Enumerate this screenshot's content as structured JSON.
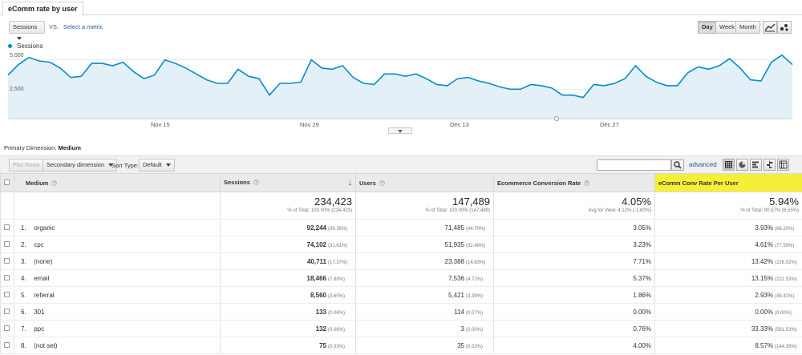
{
  "tab": {
    "label": "eComm rate by user"
  },
  "controls": {
    "metric_select": "Sessions",
    "vs_label": "VS.",
    "select_metric_link": "Select a metric",
    "day": "Day",
    "week": "Week",
    "month": "Month"
  },
  "chart_data": {
    "type": "area",
    "series": [
      {
        "name": "Sessions",
        "values": [
          3700,
          4600,
          5200,
          4900,
          4800,
          4300,
          3500,
          3600,
          4700,
          4700,
          4500,
          4800,
          4000,
          3400,
          3700,
          5000,
          4700,
          4300,
          3800,
          3300,
          3000,
          3000,
          4200,
          3600,
          3400,
          2000,
          3000,
          3000,
          3100,
          5000,
          4300,
          4200,
          4500,
          3500,
          3000,
          2900,
          3800,
          3800,
          3600,
          3800,
          3400,
          2900,
          2800,
          3400,
          3500,
          3200,
          3000,
          2700,
          2500,
          2500,
          2900,
          2800,
          2600,
          2000,
          2000,
          1800,
          2900,
          2800,
          3000,
          3400,
          4500,
          3600,
          3100,
          2800,
          2800,
          3900,
          4400,
          4200,
          4500,
          5100,
          4300,
          3300,
          3200,
          4800,
          5400,
          4600
        ]
      }
    ],
    "x_tick_labels": [
      "Nov 15",
      "Nov 29",
      "Dec 13",
      "Dec 27"
    ],
    "y_tick_labels": [
      "5,000",
      "2,500"
    ],
    "ylim": [
      0,
      6000
    ],
    "color": "#058dc7",
    "fill": "#e4f0f8",
    "grid": true
  },
  "primary_dimension": {
    "label": "Primary Dimension:",
    "value": "Medium"
  },
  "toolbar": {
    "plot_rows": "Plot Rows",
    "secondary_dimension": "Secondary dimension",
    "sort_type_label": "Sort Type:",
    "sort_type_value": "Default",
    "advanced": "advanced"
  },
  "table": {
    "headers": {
      "medium": "Medium",
      "sessions": "Sessions",
      "users": "Users",
      "ecr": "Ecommerce Conversion Rate",
      "ecomm_user": "eComm Conv Rate Per User"
    },
    "totals": {
      "sessions": "234,423",
      "sessions_sub": "% of Total: 100.00% (234,423)",
      "users": "147,489",
      "users_sub": "% of Total: 100.00% (147,489)",
      "ecr": "4.05%",
      "ecr_sub": "Avg for View: 4.12% (-1.80%)",
      "ecomm_user": "5.94%",
      "ecomm_user_sub": "% of Total: 90.57% (6.55%)"
    },
    "rows": [
      {
        "idx": "1.",
        "medium": "organic",
        "sessions": "92,244",
        "sessions_pct": "(39.35%)",
        "users": "71,485",
        "users_pct": "(44.70%)",
        "ecr": "3.05%",
        "eu": "3.93%",
        "eu_pct": "(66.20%)"
      },
      {
        "idx": "2.",
        "medium": "cpc",
        "sessions": "74,102",
        "sessions_pct": "(31.61%)",
        "users": "51,935",
        "users_pct": "(32.48%)",
        "ecr": "3.23%",
        "eu": "4.61%",
        "eu_pct": "(77.59%)"
      },
      {
        "idx": "3.",
        "medium": "(none)",
        "sessions": "40,711",
        "sessions_pct": "(17.37%)",
        "users": "23,388",
        "users_pct": "(14.63%)",
        "ecr": "7.71%",
        "eu": "13.42%",
        "eu_pct": "(226.02%)"
      },
      {
        "idx": "4.",
        "medium": "email",
        "sessions": "18,466",
        "sessions_pct": "(7.88%)",
        "users": "7,536",
        "users_pct": "(4.71%)",
        "ecr": "5.37%",
        "eu": "13.15%",
        "eu_pct": "(221.53%)"
      },
      {
        "idx": "5.",
        "medium": "referral",
        "sessions": "8,560",
        "sessions_pct": "(3.65%)",
        "users": "5,421",
        "users_pct": "(3.39%)",
        "ecr": "1.86%",
        "eu": "2.93%",
        "eu_pct": "(49.41%)"
      },
      {
        "idx": "6.",
        "medium": "301",
        "sessions": "133",
        "sessions_pct": "(0.06%)",
        "users": "114",
        "users_pct": "(0.07%)",
        "ecr": "0.00%",
        "eu": "0.00%",
        "eu_pct": "(0.00%)"
      },
      {
        "idx": "7.",
        "medium": "ppc",
        "sessions": "132",
        "sessions_pct": "(0.06%)",
        "users": "3",
        "users_pct": "(0.00%)",
        "ecr": "0.76%",
        "eu": "33.33%",
        "eu_pct": "(561.53%)"
      },
      {
        "idx": "8.",
        "medium": "(not set)",
        "sessions": "75",
        "sessions_pct": "(0.03%)",
        "users": "35",
        "users_pct": "(0.02%)",
        "ecr": "4.00%",
        "eu": "8.57%",
        "eu_pct": "(144.39%)"
      }
    ]
  }
}
